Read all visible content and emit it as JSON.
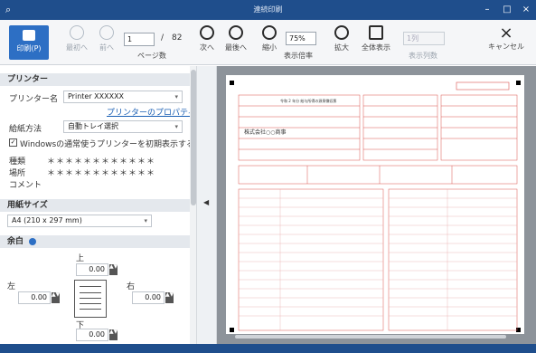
{
  "window": {
    "title": "連続印刷",
    "app_icon": "search-icon",
    "minimize": "–",
    "maximize": "□",
    "close": "×"
  },
  "toolbar": {
    "print_label": "印刷(P)",
    "first_label": "最初へ",
    "prev_label": "前へ",
    "page_value": "1",
    "page_sep": "/",
    "page_total": "82",
    "page_unit": "ページ数",
    "next_label": "次へ",
    "last_label": "最後へ",
    "shrink_label": "縮小",
    "zoom_label": "表示倍率",
    "zoom_value": "75%",
    "enlarge_label": "拡大",
    "fullscreen_label": "全体表示",
    "cols_value": "1列",
    "cols_label": "表示列数",
    "cancel_label": "キャンセル"
  },
  "sidebar": {
    "printer_section": "プリンター",
    "printer_name_label": "プリンター名",
    "printer_name_value": "Printer XXXXXX",
    "printer_properties_link": "プリンターのプロパティ",
    "paper_method_label": "給紙方法",
    "paper_method_value": "自動トレイ選択",
    "default_printer_checkbox": "Windowsの通常使うプリンターを初期表示する",
    "type_label": "種類",
    "type_value": "＊＊＊＊＊＊＊＊＊＊＊＊",
    "location_label": "場所",
    "location_value": "＊＊＊＊＊＊＊＊＊＊＊＊",
    "comment_label": "コメント",
    "paper_size_section": "用紙サイズ",
    "paper_size_value": "A4 (210 x 297 mm)",
    "margin_section": "余白",
    "margin_top_label": "上",
    "margin_top_value": "0.00",
    "margin_left_label": "左",
    "margin_left_value": "0.00",
    "margin_right_label": "右",
    "margin_right_value": "0.00",
    "margin_bottom_label": "下",
    "margin_bottom_value": "0.00"
  },
  "preview": {
    "company_name": "株式会社○○商事",
    "form_label": "令和 2 年分 給与所得の源泉徴収票"
  },
  "colors": {
    "titlebar": "#1f4e8c",
    "print_button": "#2d6fc4",
    "form_red": "#d9534f"
  }
}
